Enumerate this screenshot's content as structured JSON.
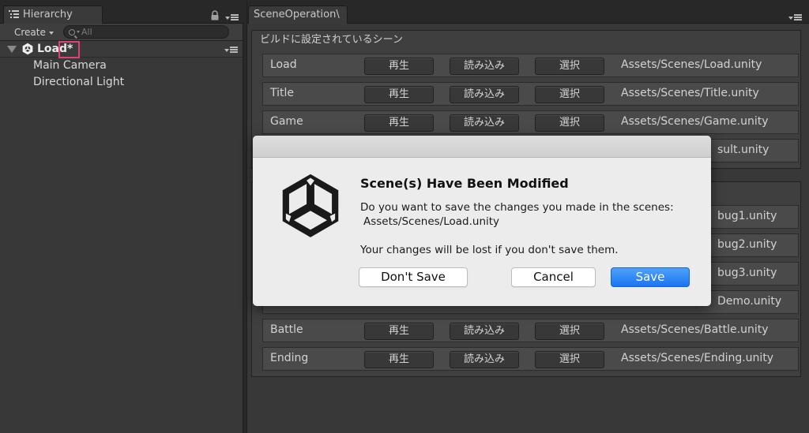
{
  "hierarchy": {
    "tab_label": "Hierarchy",
    "create_label": "Create",
    "search_placeholder": "All",
    "scene": {
      "name": "Load",
      "modified_marker": "*"
    },
    "objects": [
      "Main Camera",
      "Directional Light"
    ]
  },
  "scene_operation": {
    "tab_label": "SceneOperation\\",
    "build_group_title": "ビルドに設定されているシーン",
    "button_labels": {
      "play": "再生",
      "load": "読み込み",
      "select": "選択"
    },
    "build_scenes": [
      {
        "name": "Load",
        "path": "Assets/Scenes/Load.unity"
      },
      {
        "name": "Title",
        "path": "Assets/Scenes/Title.unity"
      },
      {
        "name": "Game",
        "path": "Assets/Scenes/Game.unity"
      },
      {
        "name": "",
        "path": "sult.unity"
      }
    ],
    "other_scenes": [
      {
        "name": "",
        "path": "bug1.unity"
      },
      {
        "name": "",
        "path": "bug2.unity"
      },
      {
        "name": "",
        "path": "bug3.unity"
      },
      {
        "name": "",
        "path": "Demo.unity"
      },
      {
        "name": "Battle",
        "path": "Assets/Scenes/Battle.unity"
      },
      {
        "name": "Ending",
        "path": "Assets/Scenes/Ending.unity"
      }
    ]
  },
  "dialog": {
    "title": "Scene(s) Have Been Modified",
    "message": "Do you want to save the changes you made in the scenes:",
    "scene_path": "Assets/Scenes/Load.unity",
    "note": "Your changes will be lost if you don't save them.",
    "buttons": {
      "dont_save": "Don't Save",
      "cancel": "Cancel",
      "save": "Save"
    }
  },
  "colors": {
    "accent_save": "#1a74f0",
    "modified_highlight": "#e2407a",
    "editor_background": "#383838",
    "dialog_background": "#ececec"
  },
  "icons": [
    "list-icon",
    "lock-icon",
    "panel-menu-icon",
    "search-icon",
    "unity-scene-icon",
    "unity-logo-icon",
    "foldout-arrow-icon"
  ]
}
